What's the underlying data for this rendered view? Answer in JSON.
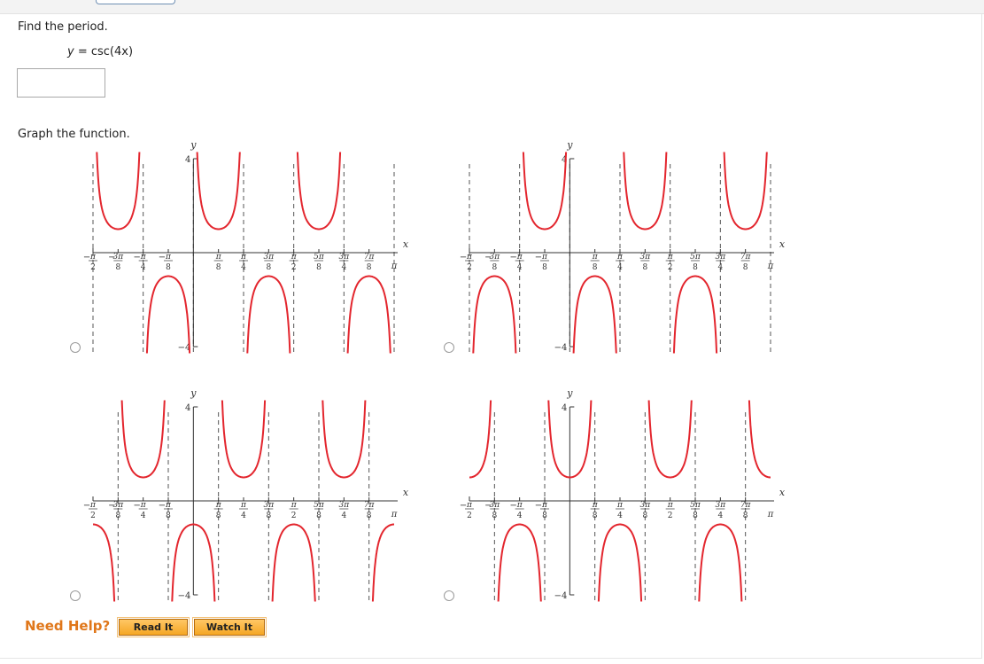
{
  "question": {
    "find_period": "Find the period.",
    "equation_y": "y",
    "equation_rest": " = csc(4x)",
    "answer_value": "",
    "graph_prompt": "Graph the function."
  },
  "graph_labels": {
    "y_axis": "y",
    "x_axis": "x",
    "y_top": "4",
    "y_bottom": "−4",
    "pi": "π"
  },
  "x_ticks": [
    {
      "x": -1.5708,
      "num": "π",
      "den": "2",
      "neg": true
    },
    {
      "x": -1.1781,
      "num": "3π",
      "den": "8",
      "neg": true
    },
    {
      "x": -0.7854,
      "num": "π",
      "den": "4",
      "neg": true
    },
    {
      "x": -0.3927,
      "num": "π",
      "den": "8",
      "neg": true
    },
    {
      "x": 0.3927,
      "num": "π",
      "den": "8",
      "neg": false
    },
    {
      "x": 0.7854,
      "num": "π",
      "den": "4",
      "neg": false
    },
    {
      "x": 1.1781,
      "num": "3π",
      "den": "8",
      "neg": false
    },
    {
      "x": 1.5708,
      "num": "π",
      "den": "2",
      "neg": false
    },
    {
      "x": 1.9635,
      "num": "5π",
      "den": "8",
      "neg": false
    },
    {
      "x": 2.3562,
      "num": "3π",
      "den": "4",
      "neg": false
    },
    {
      "x": 2.7489,
      "num": "7π",
      "den": "8",
      "neg": false
    }
  ],
  "chart_data": [
    {
      "type": "line",
      "option": 1,
      "function": "csc",
      "frequency": 4,
      "phase": 0,
      "flip": false,
      "xlim": [
        -1.5708,
        3.1416
      ],
      "ylim": [
        -4,
        4
      ],
      "color": "#e3262e"
    },
    {
      "type": "line",
      "option": 2,
      "function": "csc",
      "frequency": 4,
      "phase": 0,
      "flip": true,
      "xlim": [
        -1.5708,
        3.1416
      ],
      "ylim": [
        -4,
        4
      ],
      "color": "#e3262e"
    },
    {
      "type": "line",
      "option": 3,
      "function": "csc",
      "frequency": 4,
      "phase": 0.3927,
      "flip": false,
      "xlim": [
        -1.5708,
        3.1416
      ],
      "ylim": [
        -4,
        4
      ],
      "color": "#e3262e"
    },
    {
      "type": "line",
      "option": 4,
      "function": "csc",
      "frequency": 4,
      "phase": 0.3927,
      "flip": true,
      "xlim": [
        -1.5708,
        3.1416
      ],
      "ylim": [
        -4,
        4
      ],
      "color": "#e3262e"
    }
  ],
  "help": {
    "need_help": "Need Help?",
    "read_it": "Read It",
    "watch_it": "Watch It"
  }
}
